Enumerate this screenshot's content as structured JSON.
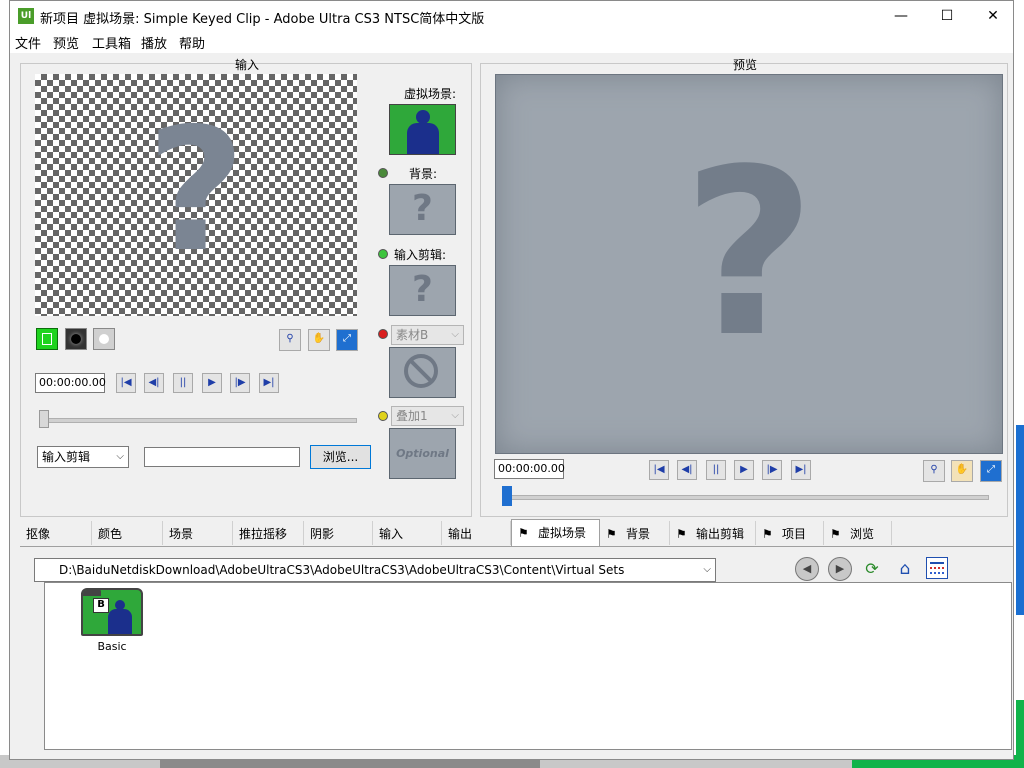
{
  "window": {
    "app_icon_label": "Ul",
    "title": "新项目  虚拟场景: Simple Keyed Clip   - Adobe Ultra CS3 NTSC简体中文版",
    "minimize": "—",
    "maximize": "☐",
    "close": "✕"
  },
  "menu": [
    "文件",
    "预览",
    "工具箱",
    "播放",
    "帮助"
  ],
  "input_panel": {
    "title": "输入",
    "timecode": "00:00:00.00",
    "source_select": "输入剪辑",
    "path_value": "",
    "browse_label": "浏览..."
  },
  "scene_column": {
    "virtual_scene_label": "虚拟场景:",
    "background_label": "背景:",
    "input_clip_label": "输入剪辑:",
    "material_select": "素材B",
    "overlay_select": "叠加1",
    "optional_label": "Optional",
    "led_colors": {
      "background": "#4a8a3a",
      "input_clip": "#3ec43e",
      "material": "#d81e1e",
      "overlay": "#e0d21a"
    }
  },
  "preview_panel": {
    "title": "预览",
    "timecode": "00:00:00.00"
  },
  "tabs": [
    {
      "label": "抠像"
    },
    {
      "label": "颜色"
    },
    {
      "label": "场景"
    },
    {
      "label": "推拉摇移"
    },
    {
      "label": "阴影"
    },
    {
      "label": "输入"
    },
    {
      "label": "输出"
    },
    {
      "label": "虚拟场景",
      "selected": true
    },
    {
      "label": "背景"
    },
    {
      "label": "输出剪辑"
    },
    {
      "label": "项目"
    },
    {
      "label": "浏览"
    }
  ],
  "browser": {
    "path": "D:\\BaiduNetdiskDownload\\AdobeUltraCS3\\AdobeUltraCS3\\AdobeUltraCS3\\Content\\Virtual Sets",
    "items": [
      {
        "label": "Basic",
        "badge": "B"
      }
    ]
  },
  "colors": {
    "scene_green": "#2fa83a",
    "figure_blue": "#1b2f8c",
    "selected_blue": "#1f6fd0"
  }
}
